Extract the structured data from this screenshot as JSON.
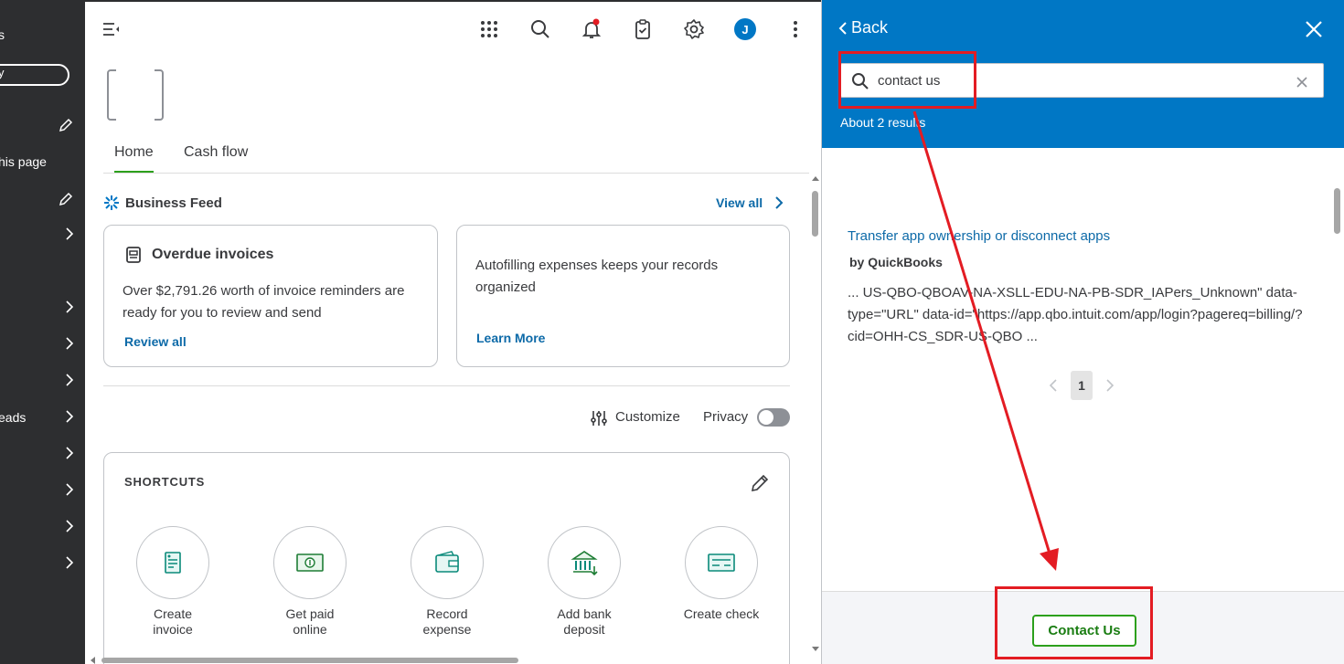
{
  "sidebar": {
    "fragments": [
      "s",
      "y",
      "his page",
      "eads"
    ]
  },
  "main": {
    "avatar_initial": "J",
    "tabs": [
      {
        "label": "Home"
      },
      {
        "label": "Cash flow"
      }
    ],
    "business_feed": {
      "title": "Business Feed",
      "view_all": "View all"
    },
    "cards": [
      {
        "title": "Overdue invoices",
        "text": "Over $2,791.26 worth of invoice reminders are ready for you to review and send",
        "link": "Review all"
      },
      {
        "text": "Autofilling expenses keeps your records organized",
        "link": "Learn More"
      }
    ],
    "customize_label": "Customize",
    "privacy_label": "Privacy",
    "shortcuts": {
      "title": "SHORTCUTS",
      "items": [
        {
          "label": "Create invoice"
        },
        {
          "label": "Get paid online"
        },
        {
          "label": "Record expense"
        },
        {
          "label": "Add bank deposit"
        },
        {
          "label": "Create check"
        }
      ]
    }
  },
  "help_panel": {
    "back_label": "Back",
    "search": {
      "value": "contact us"
    },
    "results_count": "About 2 results",
    "result": {
      "title": "Transfer app ownership or disconnect apps",
      "by": "by QuickBooks",
      "snippet": "... US-QBO-QBOAV-NA-XSLL-EDU-NA-PB-SDR_IAPers_Unknown\" data-type=\"URL\" data-id=\"https://app.qbo.intuit.com/app/login?pagereq=billing/?cid=OHH-CS_SDR-US-QBO ..."
    },
    "page_number": "1",
    "contact_button": "Contact Us"
  },
  "colors": {
    "brand_blue": "#0077c5",
    "brand_green": "#2ca01c",
    "annotation_red": "#e31c23",
    "sidebar_dark": "#2d2e30"
  }
}
